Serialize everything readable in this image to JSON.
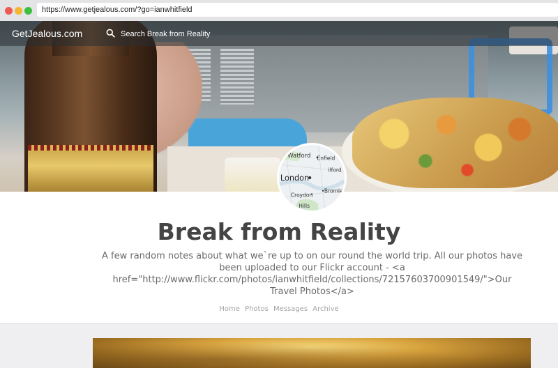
{
  "browser": {
    "url": "https://www.getjealous.com/?go=ianwhitfield"
  },
  "header": {
    "brand": "GetJealous.com",
    "search_placeholder": "Search Break from Reality"
  },
  "avatar": {
    "map_labels": [
      "Watford",
      "Enfield",
      "ilford",
      "London",
      "Croydon",
      "Bromle",
      "Hills"
    ]
  },
  "blog": {
    "title": "Break from Reality",
    "description": "A few random notes about what we`re up to on our round the world trip. All our photos have been uploaded to our Flickr account - <a href=\"http://www.flickr.com/photos/ianwhitfield/collections/72157603700901549/\">Our Travel Photos</a>"
  },
  "nav": {
    "items": [
      "Home",
      "Photos",
      "Messages",
      "Archive"
    ]
  }
}
